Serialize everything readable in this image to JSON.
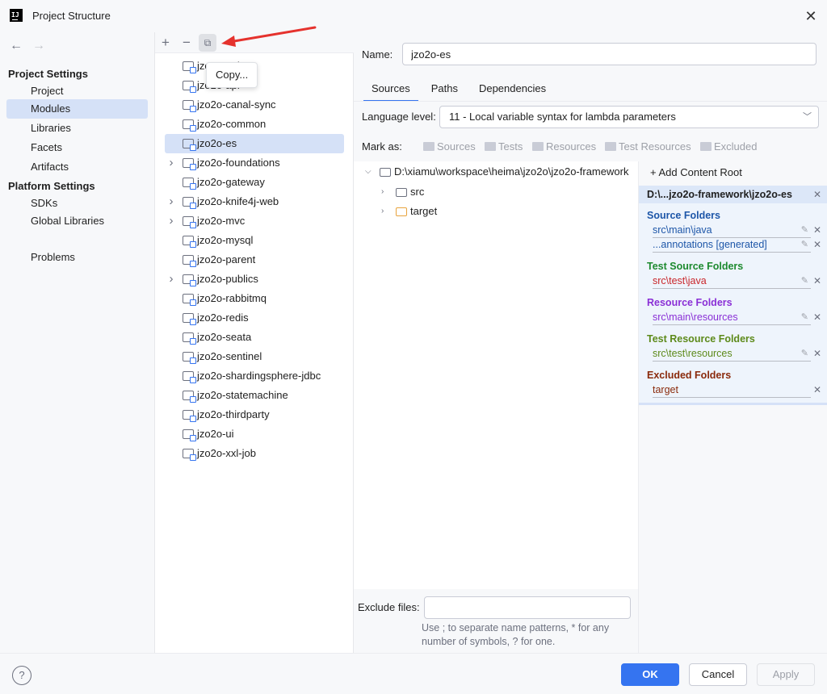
{
  "window": {
    "title": "Project Structure"
  },
  "nav": {
    "section_project": "Project Settings",
    "project_items": [
      "Project",
      "Modules",
      "Libraries",
      "Facets",
      "Artifacts"
    ],
    "section_platform": "Platform Settings",
    "platform_items": [
      "SDKs",
      "Global Libraries"
    ],
    "problems": "Problems"
  },
  "modules": {
    "tooltip": "Copy...",
    "list": [
      "jzo2o-api",
      "jzo2o-api",
      "jzo2o-canal-sync",
      "jzo2o-common",
      "jzo2o-es",
      "jzo2o-foundations",
      "jzo2o-gateway",
      "jzo2o-knife4j-web",
      "jzo2o-mvc",
      "jzo2o-mysql",
      "jzo2o-parent",
      "jzo2o-publics",
      "jzo2o-rabbitmq",
      "jzo2o-redis",
      "jzo2o-seata",
      "jzo2o-sentinel",
      "jzo2o-shardingsphere-jdbc",
      "jzo2o-statemachine",
      "jzo2o-thirdparty",
      "jzo2o-ui",
      "jzo2o-xxl-job"
    ],
    "visible_first": "jzo",
    "visible_second": "jzo2o-api"
  },
  "detail": {
    "name_label": "Name:",
    "name_value": "jzo2o-es",
    "tabs": [
      "Sources",
      "Paths",
      "Dependencies"
    ],
    "language_label": "Language level:",
    "language_value": "11 - Local variable syntax for lambda parameters",
    "mark_label": "Mark as:",
    "mark_buttons": [
      "Sources",
      "Tests",
      "Resources",
      "Test Resources",
      "Excluded"
    ],
    "content_root_path": "D:\\xiamu\\workspace\\heima\\jzo2o\\jzo2o-framework",
    "tree_src": "src",
    "tree_target": "target",
    "exclude_label": "Exclude files:",
    "hint": "Use ; to separate name patterns, * for any number of symbols, ? for one."
  },
  "roots": {
    "add_label": "Add Content Root",
    "root_title": "D:\\...jzo2o-framework\\jzo2o-es",
    "source_header": "Source Folders",
    "source_items": [
      "src\\main\\java",
      "...annotations [generated]"
    ],
    "test_header": "Test Source Folders",
    "test_item": "src\\test\\java",
    "resource_header": "Resource Folders",
    "resource_item": "src\\main\\resources",
    "test_resource_header": "Test Resource Folders",
    "test_resource_item": "src\\test\\resources",
    "excluded_header": "Excluded Folders",
    "excluded_item": "target"
  },
  "colors": {
    "source": "#1d56a8",
    "test": "#1d8a2f",
    "test_item": "#c9252a",
    "resource": "#8a2fd6",
    "test_resource": "#5d8a1a",
    "excluded": "#8a2a0b",
    "accent": "#3574f0"
  },
  "footer": {
    "ok": "OK",
    "cancel": "Cancel",
    "apply": "Apply",
    "help": "?"
  }
}
